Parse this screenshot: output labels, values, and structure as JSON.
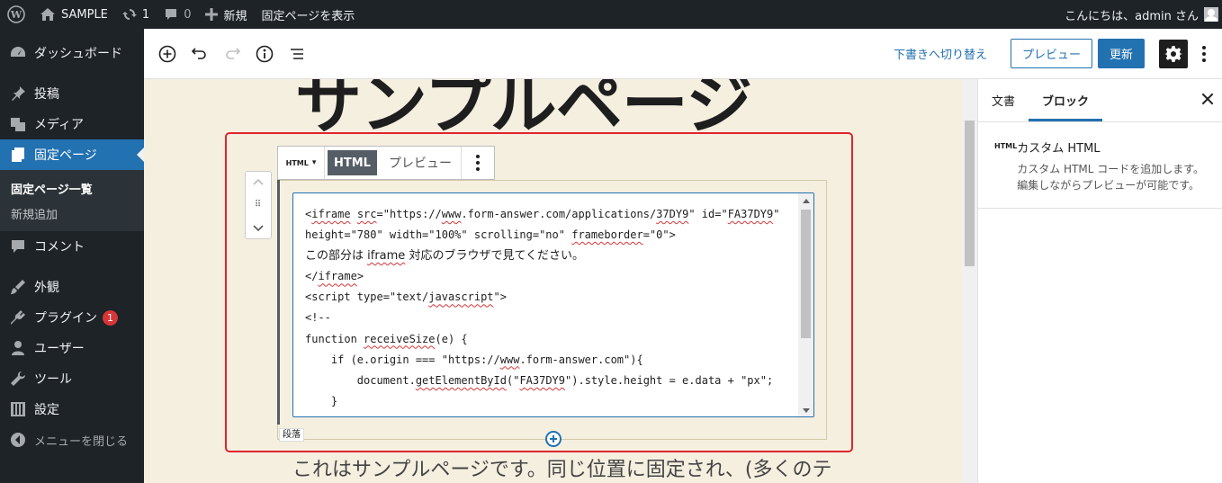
{
  "admin_bar": {
    "site_name": "SAMPLE",
    "updates_count": "1",
    "comments_count": "0",
    "new_label": "新規",
    "view_page": "固定ページを表示",
    "greeting": "こんにちは、admin さん"
  },
  "sidebar": {
    "items": [
      {
        "label": "ダッシュボード",
        "icon": "dashboard-icon"
      },
      {
        "label": "投稿",
        "icon": "pin-icon"
      },
      {
        "label": "メディア",
        "icon": "media-icon"
      },
      {
        "label": "固定ページ",
        "icon": "pages-icon"
      },
      {
        "label": "コメント",
        "icon": "comment-icon"
      },
      {
        "label": "外観",
        "icon": "appearance-icon"
      },
      {
        "label": "プラグイン",
        "icon": "plugin-icon",
        "badge": "1"
      },
      {
        "label": "ユーザー",
        "icon": "user-icon"
      },
      {
        "label": "ツール",
        "icon": "tools-icon"
      },
      {
        "label": "設定",
        "icon": "settings-icon"
      }
    ],
    "submenu": [
      "固定ページ一覧",
      "新規追加"
    ],
    "collapse_label": "メニューを閉じる"
  },
  "editor_toolbar": {
    "switch_to_draft": "下書きへ切り替え",
    "preview": "プレビュー",
    "update": "更新"
  },
  "page_title": "サンプルページ",
  "block_toolbar": {
    "block_type": "HTML",
    "html_tab": "HTML",
    "preview_tab": "プレビュー"
  },
  "code": {
    "lines": [
      "<iframe src=\"https://www.form-answer.com/applications/37DY9\" id=\"FA37DY9\"",
      "height=\"780\" width=\"100%\" scrolling=\"no\" frameborder=\"0\">",
      "この部分は iframe 対応のブラウザで見てください。",
      "</iframe>",
      "<script type=\"text/javascript\">",
      "<!--",
      "function receiveSize(e) {",
      "    if (e.origin === \"https://www.form-answer.com\"){",
      "        document.getElementById(\"FA37DY9\").style.height = e.data + \"px\";",
      "    }",
      "}"
    ]
  },
  "paragraph_label": "段落",
  "paragraph_text": "これはサンプルページです。同じ位置に固定され、(多くのテ",
  "right_panel": {
    "tab_document": "文書",
    "tab_block": "ブロック",
    "block_icon_text": "HTML",
    "block_title": "カスタム HTML",
    "block_description": "カスタム HTML コードを追加します。編集しながらプレビューが可能です。"
  },
  "colors": {
    "admin_dark": "#1d2327",
    "accent": "#2271b1",
    "canvas_bg": "#f5efe0",
    "highlight": "#e0232d"
  }
}
